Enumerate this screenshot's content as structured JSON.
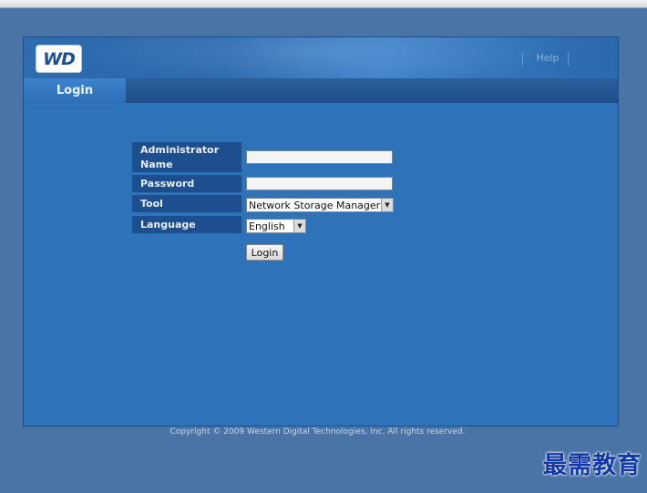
{
  "header": {
    "logo_text": "WD",
    "help_link": "Help"
  },
  "tabs": [
    {
      "label": "Login"
    }
  ],
  "form": {
    "admin_name_label": "Administrator Name",
    "admin_name_value": "",
    "password_label": "Password",
    "password_value": "",
    "tool_label": "Tool",
    "tool_selected": "Network Storage Manager",
    "language_label": "Language",
    "language_selected": "English",
    "login_button": "Login"
  },
  "footer": {
    "copyright": "Copyright © 2009 Western Digital Technologies, Inc. All rights reserved."
  },
  "watermark": "最需教育",
  "colors": {
    "page_background": "#4a73a6",
    "panel_background": "#2e72ba",
    "label_background": "#1d4f8e",
    "watermark": "#1238a8"
  }
}
